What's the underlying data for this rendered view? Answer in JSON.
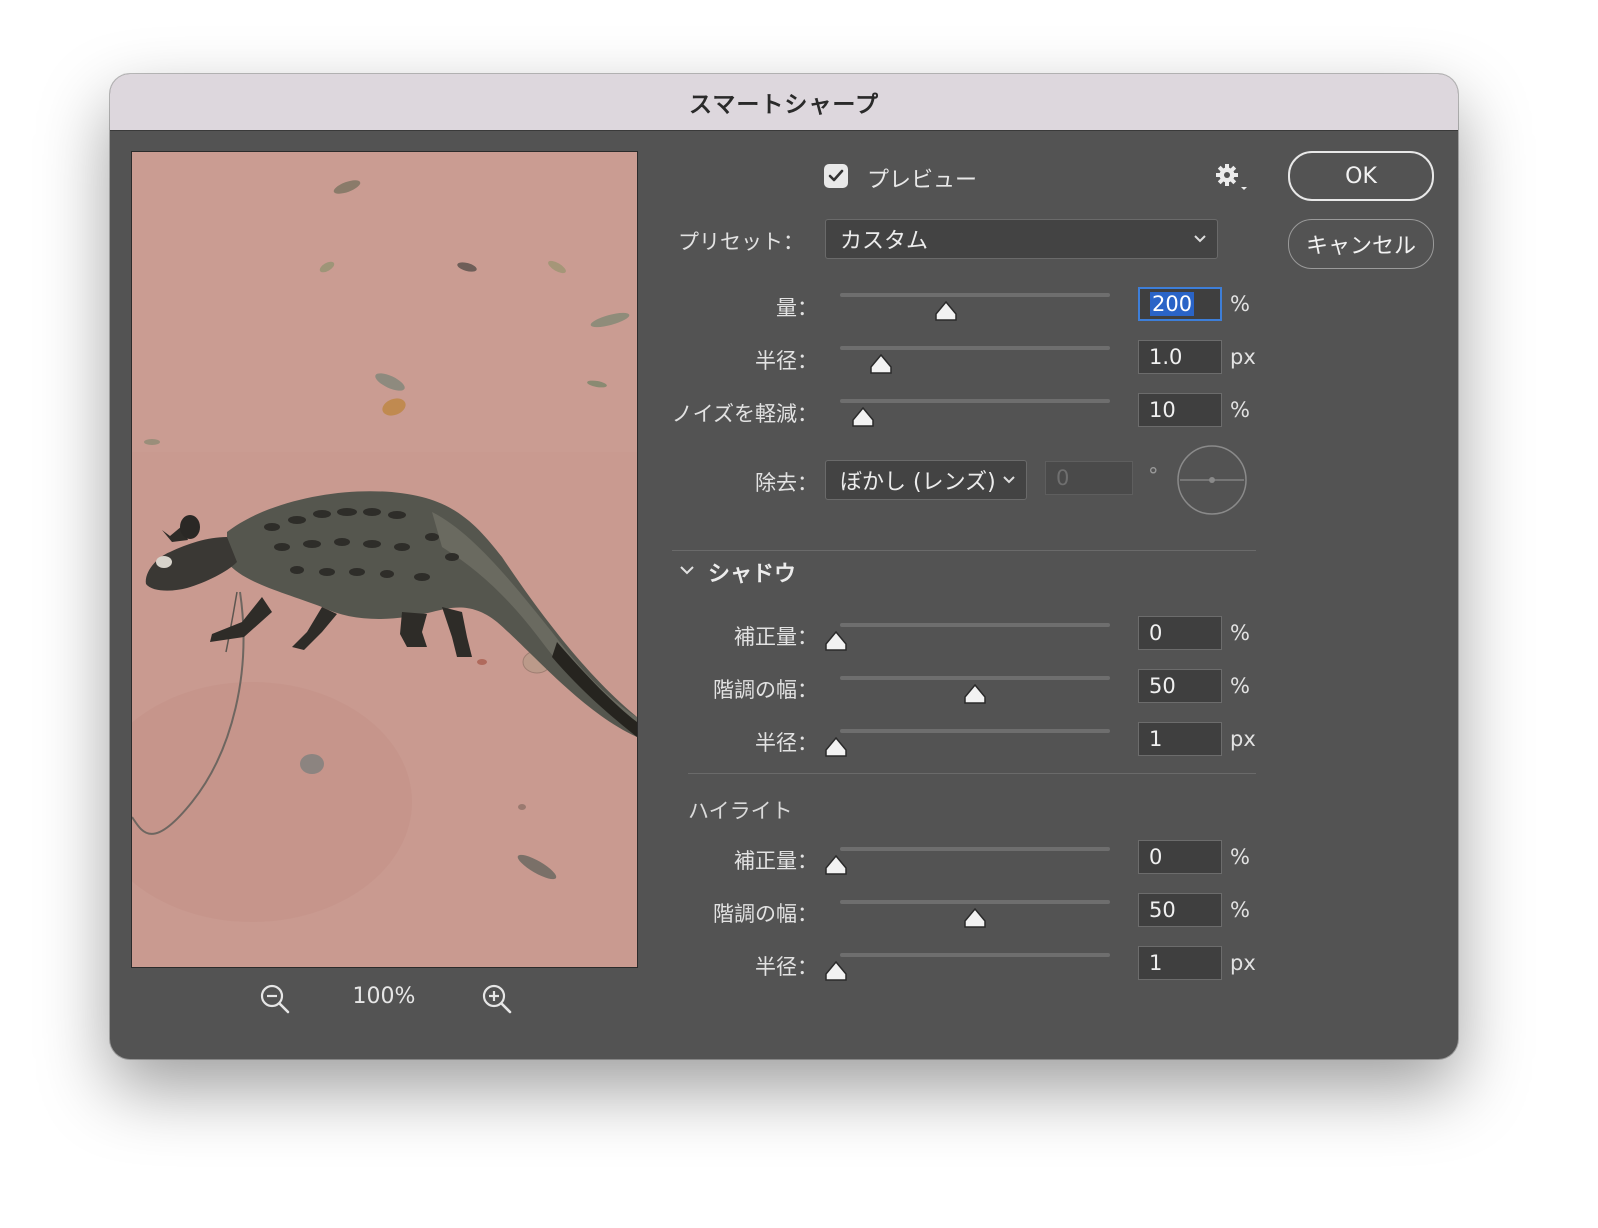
{
  "dialog": {
    "title": "スマートシャープ"
  },
  "preview": {
    "checkbox_checked": true,
    "label": "プレビュー",
    "zoom_level": "100%"
  },
  "buttons": {
    "ok": "OK",
    "cancel": "キャンセル"
  },
  "preset": {
    "label": "プリセット：",
    "value": "カスタム"
  },
  "sliders": {
    "amount": {
      "label": "量：",
      "value": "200",
      "unit": "%",
      "max": 500
    },
    "radius": {
      "label": "半径：",
      "value": "1.0",
      "unit": "px",
      "max": 64
    },
    "noise": {
      "label": "ノイズを軽減：",
      "value": "10",
      "unit": "%",
      "max": 100
    }
  },
  "remove": {
    "label": "除去：",
    "value": "ぼかし (レンズ)",
    "angle": "0",
    "angle_unit": "°"
  },
  "shadow": {
    "heading": "シャドウ",
    "fade": {
      "label": "補正量：",
      "value": "0",
      "unit": "%"
    },
    "tonal_width": {
      "label": "階調の幅：",
      "value": "50",
      "unit": "%"
    },
    "radius": {
      "label": "半径：",
      "value": "1",
      "unit": "px"
    }
  },
  "highlight": {
    "heading": "ハイライト",
    "fade": {
      "label": "補正量：",
      "value": "0",
      "unit": "%"
    },
    "tonal_width": {
      "label": "階調の幅：",
      "value": "50",
      "unit": "%"
    },
    "radius": {
      "label": "半径：",
      "value": "1",
      "unit": "px"
    }
  },
  "icons": {
    "gear": "gear-icon",
    "zoom_out": "zoom-out-icon",
    "zoom_in": "zoom-in-icon",
    "check": "checkmark-icon",
    "chevron": "chevron-down-icon"
  },
  "colors": {
    "panel": "#535353",
    "titlebar": "#ddd7dd",
    "field_highlight": "#2a64c7",
    "preview_ground": "#c9978d"
  }
}
